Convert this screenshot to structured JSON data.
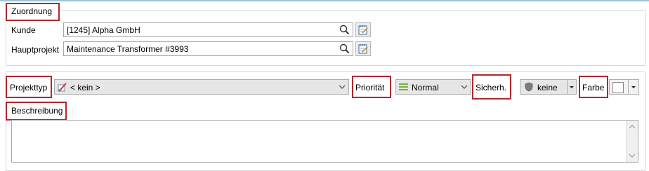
{
  "assignment": {
    "title": "Zuordnung",
    "customer": {
      "label": "Kunde",
      "value": "[1245] Alpha GmbH",
      "search_icon": "search-icon",
      "edit_icon": "notepad-edit-icon"
    },
    "main_project": {
      "label": "Hauptprojekt",
      "value": "Maintenance Transformer #3993",
      "search_icon": "search-icon",
      "edit_icon": "notepad-edit-icon"
    }
  },
  "project": {
    "type": {
      "label": "Projekttyp",
      "value": "< kein >",
      "icon": "broken-edit-icon"
    },
    "priority": {
      "label": "Priorität",
      "value": "Normal",
      "icon": "three-lines-icon",
      "icon_color": "#6fb33c"
    },
    "security": {
      "label": "Sicherh.",
      "value": "keine",
      "icon": "shield-icon"
    },
    "color": {
      "label": "Farbe",
      "swatch": "#ffffff"
    }
  },
  "description": {
    "label": "Beschreibung",
    "value": ""
  },
  "colors": {
    "highlight": "#b0282e",
    "accent_line": "#9ec3d6"
  }
}
